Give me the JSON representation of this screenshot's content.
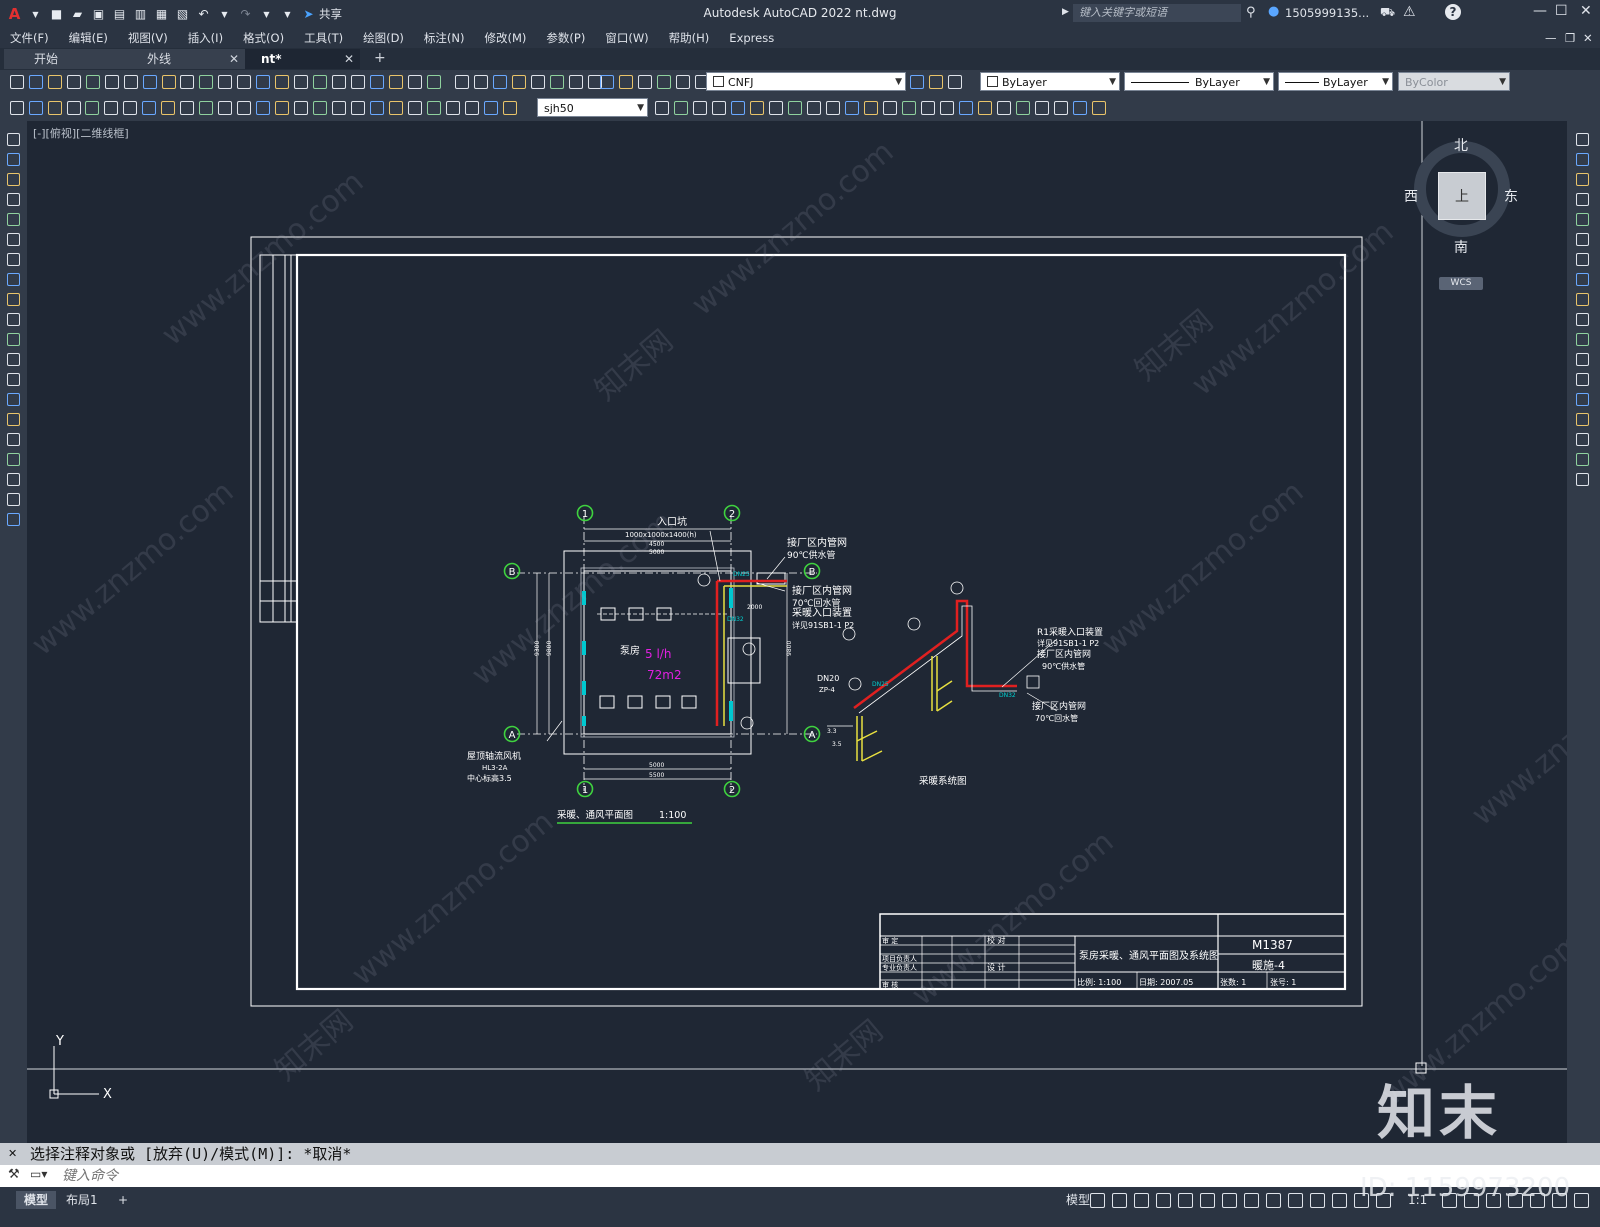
{
  "app_title": "Autodesk AutoCAD 2022    nt.dwg",
  "share_label": "共享",
  "search": {
    "placeholder": "键入关键字或短语"
  },
  "user": {
    "name": "1505999135..."
  },
  "menu": [
    "文件(F)",
    "编辑(E)",
    "视图(V)",
    "插入(I)",
    "格式(O)",
    "工具(T)",
    "绘图(D)",
    "标注(N)",
    "修改(M)",
    "参数(P)",
    "窗口(W)",
    "帮助(H)",
    "Express"
  ],
  "tabs": [
    {
      "label": "开始"
    },
    {
      "label": "外线"
    },
    {
      "label": "nt*"
    }
  ],
  "toolbar": {
    "layer": "CNFJ",
    "color": "ByLayer",
    "linetype": "ByLayer",
    "lineweight": "ByLayer",
    "plotstyle": "ByColor",
    "textstyle": "sjh50"
  },
  "viewport_label": "[-][俯视][二维线框]",
  "viewcube": {
    "top": "上",
    "n": "北",
    "s": "南",
    "e": "东",
    "w": "西",
    "wcs": "WCS"
  },
  "ucs": {
    "x": "X",
    "y": "Y"
  },
  "drawing": {
    "axes": {
      "a": "A",
      "b": "B",
      "n1": "1",
      "n2": "2"
    },
    "entry_pit": "入口坑",
    "entry_pit_size": "1000x1000x1400(h)",
    "dim_top1": "4500",
    "dim_top2": "5000",
    "dim_left1": "9300",
    "dim_left2": "9800",
    "dim_right": "9800",
    "dim_bot1": "5000",
    "dim_bot2": "5500",
    "dim_2000": "2000",
    "room_label": "泵房",
    "room_flow": "5 l/h",
    "room_area": "72m2",
    "plant_net_1": "接厂区内管网",
    "supply_90": "90℃供水管",
    "plant_net_2": "接厂区内管网",
    "return_70": "70℃回水管",
    "heat_entry": "采暖入口装置",
    "see_detail": "详见91SB1-1 P2",
    "fan_label_1": "屋顶轴流风机",
    "fan_label_2": "HL3-2A",
    "fan_label_3": "中心标高3.5",
    "plan_title": "采暖、通风平面图",
    "plan_scale": "1:100",
    "dn20": "DN20",
    "zp": "ZP-4",
    "dn25a": "DN25",
    "dn25b": "DN25",
    "dn32a": "DN32",
    "dn32b": "DN32",
    "sys_entry": "R1采暖入口装置",
    "sys_detail": "详见91SB1-1 P2",
    "sys_net1": "接厂区内管网",
    "sys_supply": "90℃供水管",
    "sys_net2": "接厂区内管网",
    "sys_return": "70℃回水管",
    "h1": "3.3",
    "h2": "3.5",
    "sys_title": "采暖系统图",
    "tb_approve": "审   定",
    "tb_lead": "项目负责人",
    "tb_prof": "专业负责人",
    "tb_review": "审   核",
    "tb_check": "校   对",
    "tb_design": "设   计",
    "tb_title": "泵房采暖、通风平面图及系统图",
    "tb_no": "M1387",
    "tb_sheet": "暖施-4",
    "tb_scale": "比例: 1:100",
    "tb_date": "日期: 2007.05",
    "tb_count": "张数: 1",
    "tb_num": "张号: 1"
  },
  "command": {
    "history": "选择注释对象或 [放弃(U)/模式(M)]: *取消*",
    "placeholder": "键入命令"
  },
  "status": {
    "model": "模型",
    "layout": "布局1",
    "model_btn": "模型",
    "scale": "1:1"
  },
  "watermark": {
    "site": "www.znzmo.com",
    "cn": "知末网",
    "logo": "知末",
    "id": "ID: 1159973200"
  },
  "colors": {
    "bg": "#1f2734",
    "supply": "#e02020",
    "return": "#e8e040",
    "accent": "#00d0d0",
    "magenta": "#d020d0"
  }
}
